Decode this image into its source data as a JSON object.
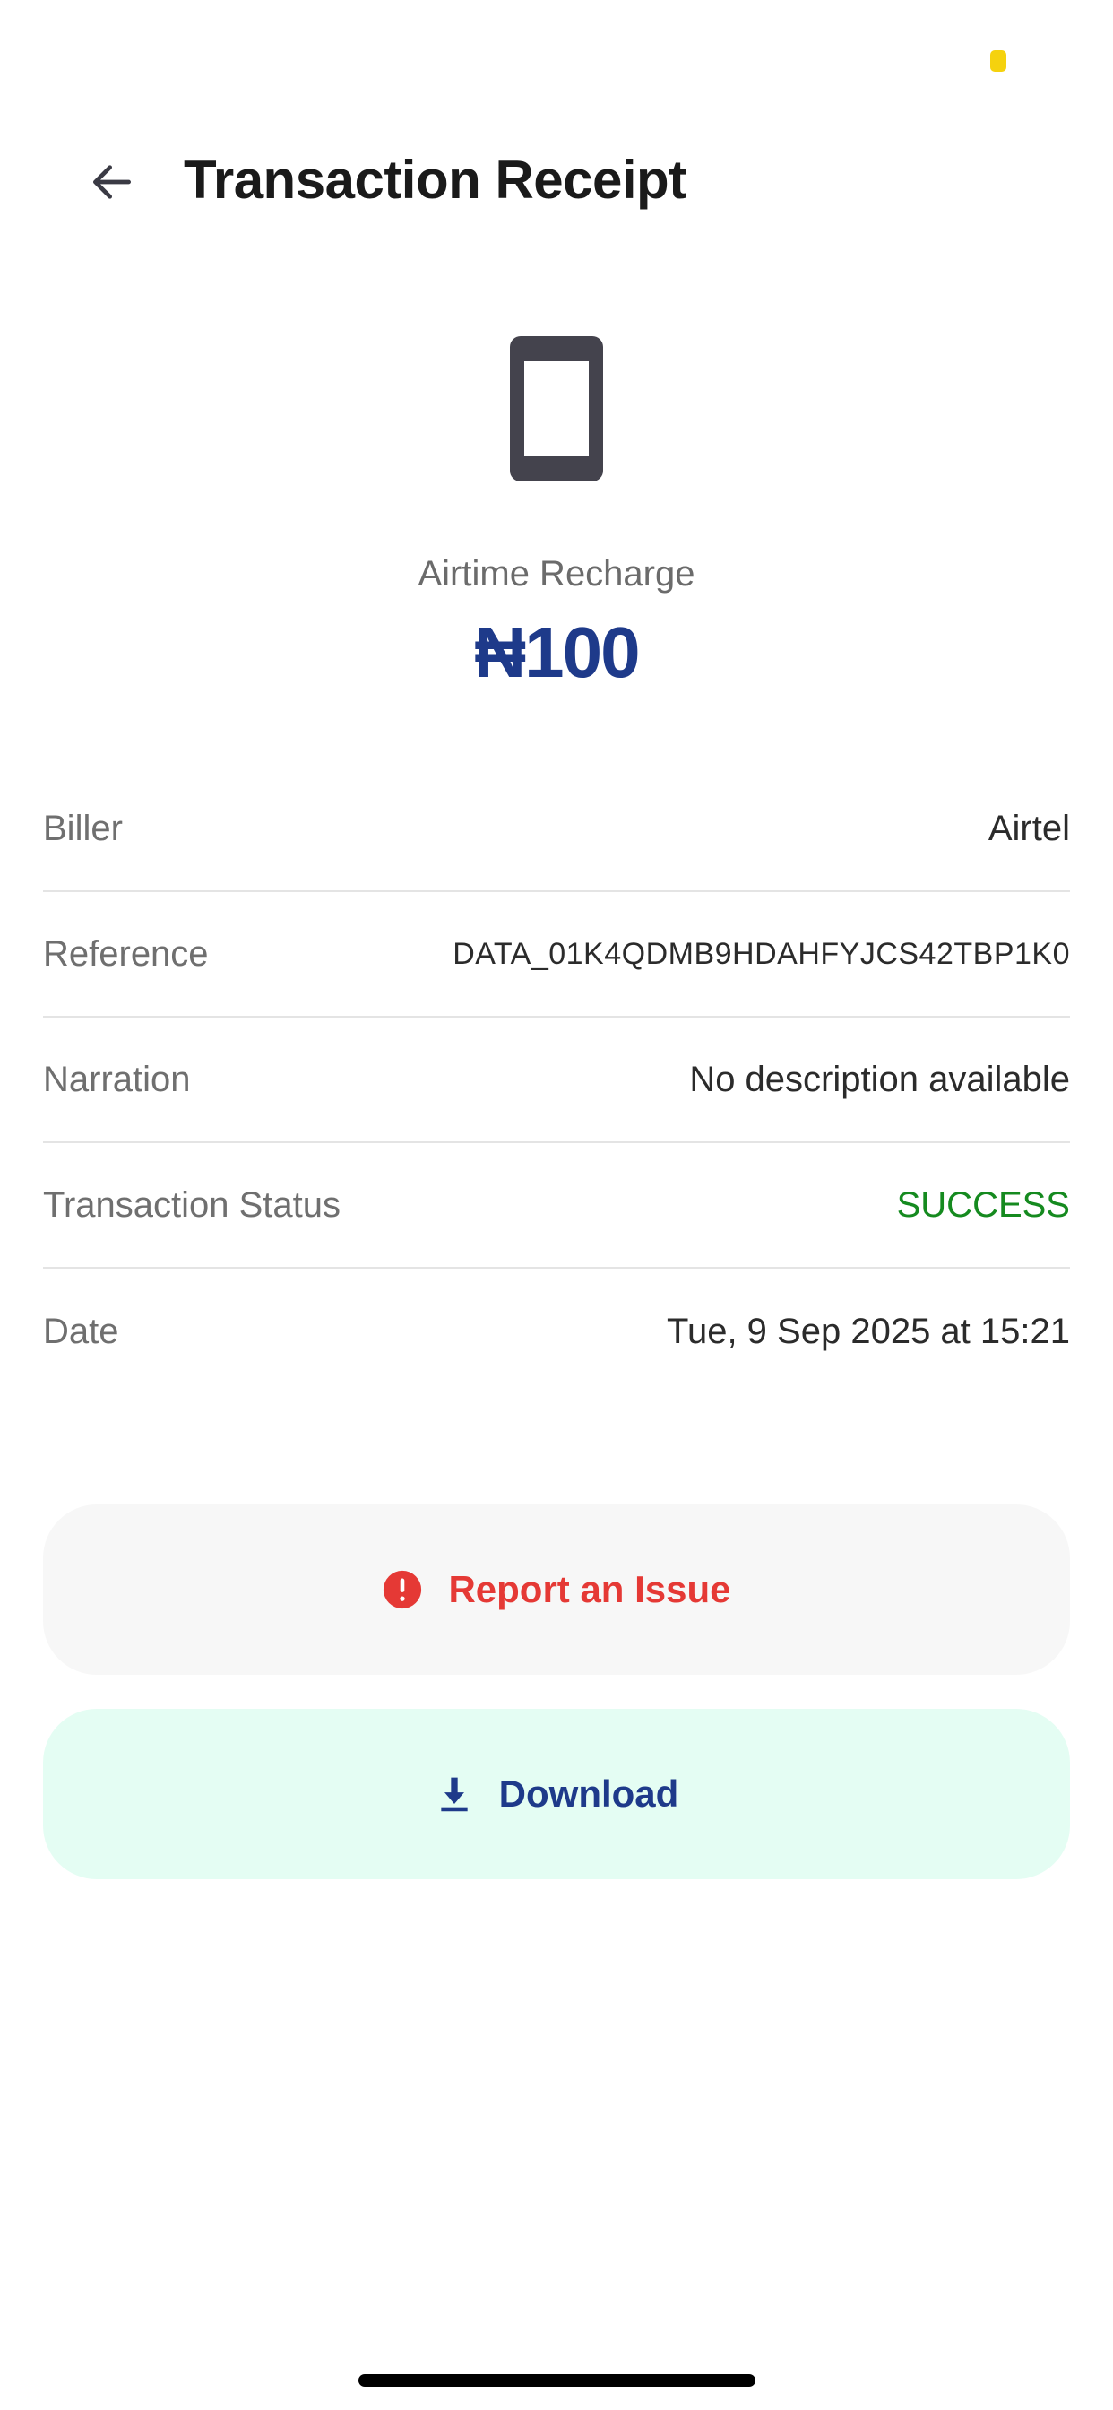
{
  "header": {
    "title": "Transaction Receipt",
    "back_icon": "arrow-left-icon"
  },
  "summary": {
    "icon": "smartphone-icon",
    "category": "Airtime Recharge",
    "amount": "₦100"
  },
  "details": [
    {
      "label": "Biller",
      "value": "Airtel"
    },
    {
      "label": "Reference",
      "value": "DATA_01K4QDMB9HDAHFYJCS42TBP1K0"
    },
    {
      "label": "Narration",
      "value": "No description available"
    },
    {
      "label": "Transaction Status",
      "value": "SUCCESS"
    },
    {
      "label": "Date",
      "value": "Tue, 9 Sep 2025 at 15:21"
    }
  ],
  "actions": {
    "report_label": "Report an Issue",
    "report_icon": "alert-circle-icon",
    "download_label": "Download",
    "download_icon": "download-icon"
  },
  "colors": {
    "accent": "#1e3a8a",
    "success": "#158a1f",
    "danger": "#e53935",
    "download_bg": "#e4fdf3",
    "report_bg": "#f7f7f7"
  }
}
